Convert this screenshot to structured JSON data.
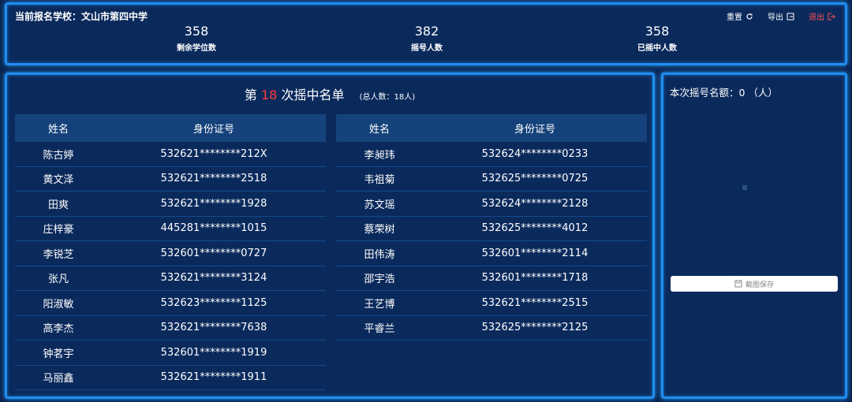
{
  "header": {
    "school": "当前报名学校：文山市第四中学",
    "actions": {
      "reset": "重置",
      "export": "导出",
      "logout": "退出"
    },
    "stats": [
      {
        "value": "358",
        "label": "剩余学位数"
      },
      {
        "value": "382",
        "label": "摇号人数"
      },
      {
        "value": "358",
        "label": "已摇中人数"
      }
    ]
  },
  "list": {
    "title_prefix": "第",
    "round": "18",
    "title_suffix": "次摇中名单",
    "total": "(总人数：18人)",
    "columns": {
      "name": "姓名",
      "id": "身份证号"
    },
    "left_rows": [
      {
        "name": "陈古婷",
        "id": "532621********212X"
      },
      {
        "name": "黄文泽",
        "id": "532621********2518"
      },
      {
        "name": "田爽",
        "id": "532621********1928"
      },
      {
        "name": "庄梓豪",
        "id": "445281********1015"
      },
      {
        "name": "李锐芝",
        "id": "532601********0727"
      },
      {
        "name": "张凡",
        "id": "532621********3124"
      },
      {
        "name": "阳淑敏",
        "id": "532623********1125"
      },
      {
        "name": "高李杰",
        "id": "532621********7638"
      },
      {
        "name": "钟茗宇",
        "id": "532601********1919"
      },
      {
        "name": "马丽鑫",
        "id": "532621********1911"
      }
    ],
    "right_rows": [
      {
        "name": "李昶玮",
        "id": "532624********0233"
      },
      {
        "name": "韦祖菊",
        "id": "532625********0725"
      },
      {
        "name": "苏文瑶",
        "id": "532624********2128"
      },
      {
        "name": "蔡荣树",
        "id": "532625********4012"
      },
      {
        "name": "田伟涛",
        "id": "532601********2114"
      },
      {
        "name": "邵宇浩",
        "id": "532601********1718"
      },
      {
        "name": "王艺博",
        "id": "532621********2515"
      },
      {
        "name": "平睿兰",
        "id": "532625********2125"
      }
    ]
  },
  "side": {
    "quota": "本次摇号名额：0 （人）",
    "save_label": "截图保存"
  },
  "colors": {
    "background": "#0a2552",
    "border": "#1f8ef1",
    "highlight": "#ff3b3b",
    "logout": "#ff4d4f"
  }
}
